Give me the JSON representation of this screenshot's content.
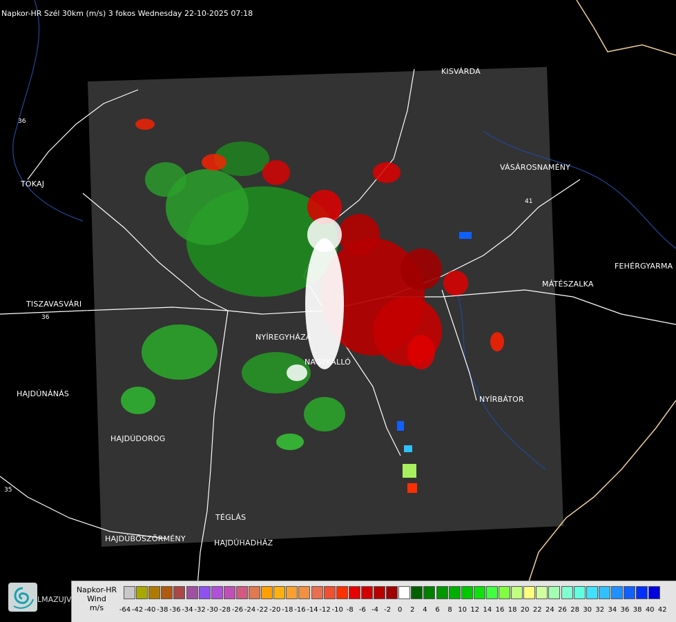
{
  "title": "Napkor-HR Szél 30km (m/s) 3 fokos Wednesday 22-10-2025 07:18",
  "cities": {
    "kisvarda": "KISVÁRDA",
    "tokaj": "TOKAJ",
    "vasarosnameny": "VÁSÁROSNAMÉNY",
    "fehergyarmat": "FEHÉRGYARMA",
    "mateszalka": "MÁTÉSZALKA",
    "tiszavasvari": "TISZAVASVÁRI",
    "nyiregyhaza": "NYÍREGYHÁZA",
    "nagykallo": "NAGYKÁLLÓ",
    "nyirbator": "NYÍRBÁTOR",
    "hajdunanas": "HAJDÚNÁNÁS",
    "hajdudorog": "HAJDÚDOROG",
    "teglas": "TÉGLÁS",
    "hajduboszormeny": "HAJDÚBÖSZÖRMÉNY",
    "hajduhadhaz": "HAJDÚHADHÁZ"
  },
  "road_numbers": {
    "r36": "36",
    "r41": "41",
    "r35": "35",
    "r1": "36"
  },
  "logo": {
    "icon": "swirl-logo-icon",
    "text": "LMAZUJVAR"
  },
  "legend": {
    "line1": "Napkor-HR",
    "line2": "Wind",
    "line3": "m/s",
    "ticks": [
      "-64",
      "-42",
      "-40",
      "-38",
      "-36",
      "-34",
      "-32",
      "-30",
      "-28",
      "-26",
      "-24",
      "-22",
      "-20",
      "-18",
      "-16",
      "-14",
      "-12",
      "-10",
      "-8",
      "-6",
      "-4",
      "-2",
      "0",
      "2",
      "4",
      "6",
      "8",
      "10",
      "12",
      "14",
      "16",
      "18",
      "20",
      "22",
      "24",
      "26",
      "28",
      "30",
      "32",
      "34",
      "36",
      "38",
      "40",
      "42"
    ],
    "colors": [
      "#c8c8c8",
      "#a8a800",
      "#b07a00",
      "#b05a10",
      "#a84848",
      "#a050a0",
      "#9050f0",
      "#b050d8",
      "#c050b8",
      "#d05a80",
      "#e07850",
      "#ffa000",
      "#ffb010",
      "#f8a030",
      "#f09040",
      "#e87050",
      "#f05030",
      "#ff3000",
      "#e80000",
      "#d00000",
      "#b80000",
      "#a00000",
      "#ffffff",
      "#006000",
      "#008000",
      "#009800",
      "#00b000",
      "#00c800",
      "#10e010",
      "#40ff40",
      "#80ff40",
      "#c0ff80",
      "#ffff80",
      "#d0ffa0",
      "#a0ffb0",
      "#80ffd0",
      "#60ffe0",
      "#40e0ff",
      "#30c0ff",
      "#2090ff",
      "#1060ff",
      "#0030ff",
      "#0000e0"
    ]
  },
  "colors": {
    "background": "#000000",
    "radar_area": "#333333",
    "outbound_wind": "#b50000",
    "inbound_wind": "#1e8a1e",
    "roads": "#ffffff",
    "rivers": "#1e4a9a",
    "border": "#f0d098"
  }
}
